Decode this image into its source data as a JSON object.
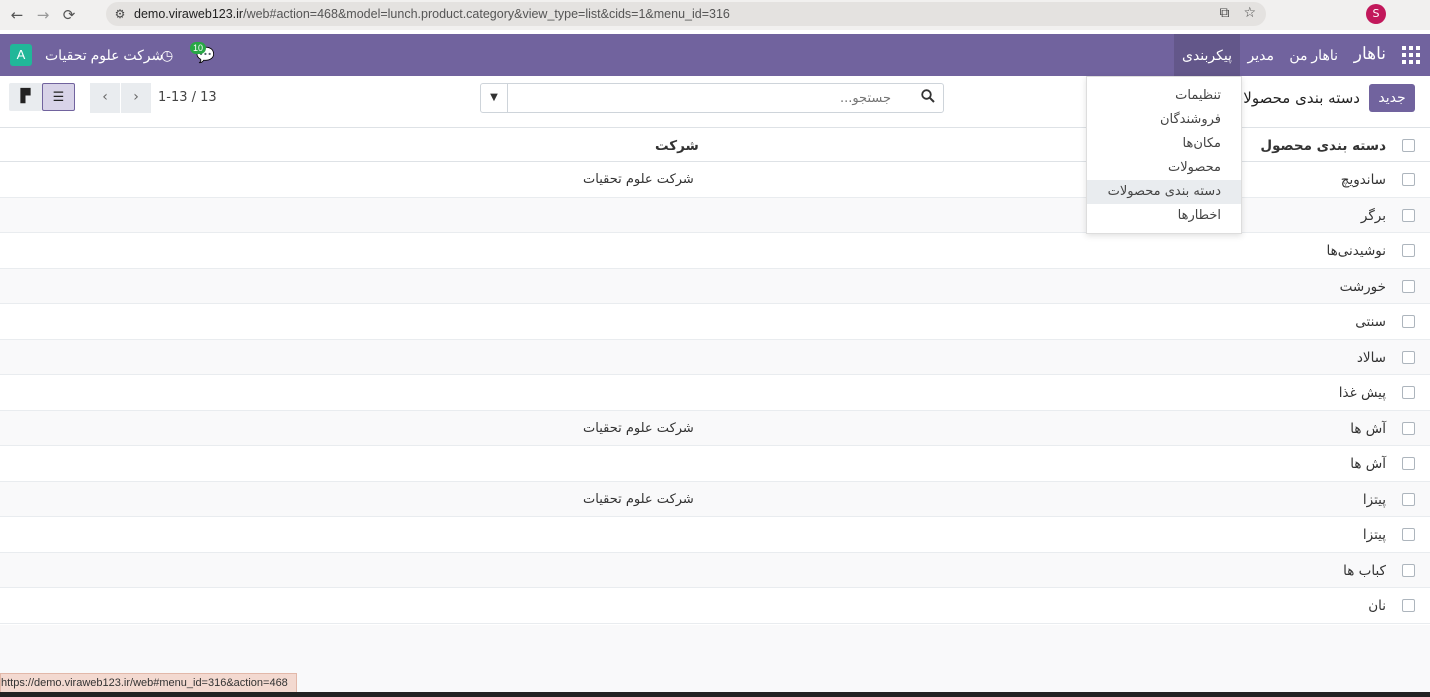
{
  "browser": {
    "url_domain": "demo.viraweb123.ir",
    "url_path": "/web#action=468&model=lunch.product.category&view_type=list&cids=1&menu_id=316",
    "profile_letter": "S"
  },
  "navbar": {
    "brand": "ناهار",
    "menu": [
      "ناهار من",
      "مدیر",
      "پیکربندی"
    ],
    "company_name": "شرکت علوم تحقیات",
    "company_badge": "A",
    "chat_count": "10"
  },
  "control": {
    "new_button": "جدید",
    "breadcrumb": "دسته بندی محصولات",
    "search_placeholder": "جستجو...",
    "pager": "1-13 / 13"
  },
  "dropdown": {
    "items": [
      "تنظیمات",
      "فروشندگان",
      "مکان‌ها",
      "محصولات",
      "دسته بندی محصولات",
      "اخطارها"
    ]
  },
  "table": {
    "headers": {
      "name": "دسته بندی محصول",
      "company": "شرکت"
    },
    "rows": [
      {
        "name": "ساندویچ",
        "company": "شرکت علوم تحقیات"
      },
      {
        "name": "برگر",
        "company": ""
      },
      {
        "name": "نوشیدنی‌ها",
        "company": ""
      },
      {
        "name": "خورشت",
        "company": ""
      },
      {
        "name": "سنتی",
        "company": ""
      },
      {
        "name": "سالاد",
        "company": ""
      },
      {
        "name": "پیش غذا",
        "company": ""
      },
      {
        "name": "آش ها",
        "company": "شرکت علوم تحقیات"
      },
      {
        "name": "آش ها",
        "company": ""
      },
      {
        "name": "پیتزا",
        "company": "شرکت علوم تحقیات"
      },
      {
        "name": "پیتزا",
        "company": ""
      },
      {
        "name": "کباب ها",
        "company": ""
      },
      {
        "name": "نان",
        "company": ""
      }
    ]
  },
  "status_link": "https://demo.viraweb123.ir/web#menu_id=316&action=468",
  "colors": {
    "primary": "#71639e",
    "badge": "#21b799"
  }
}
